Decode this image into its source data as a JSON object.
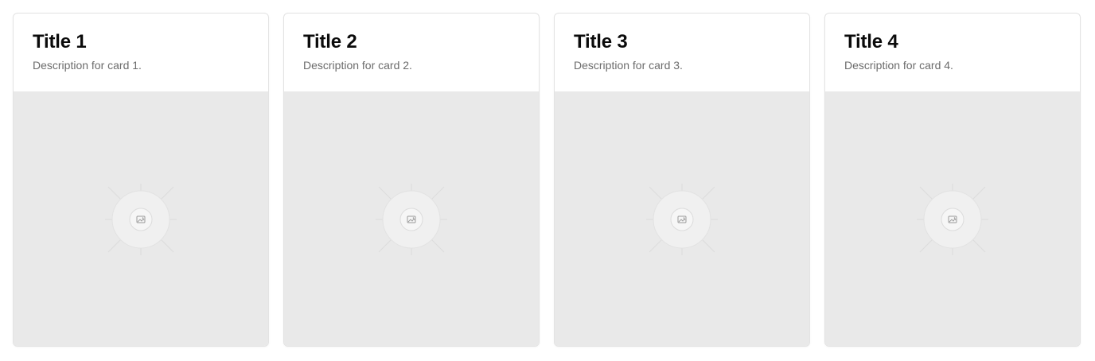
{
  "cards": [
    {
      "title": "Title 1",
      "description": "Description for card 1."
    },
    {
      "title": "Title 2",
      "description": "Description for card 2."
    },
    {
      "title": "Title 3",
      "description": "Description for card 3."
    },
    {
      "title": "Title 4",
      "description": "Description for card 4."
    }
  ],
  "media": {
    "placeholder_icon": "image-placeholder-icon",
    "background_color": "#e9e9e9"
  }
}
